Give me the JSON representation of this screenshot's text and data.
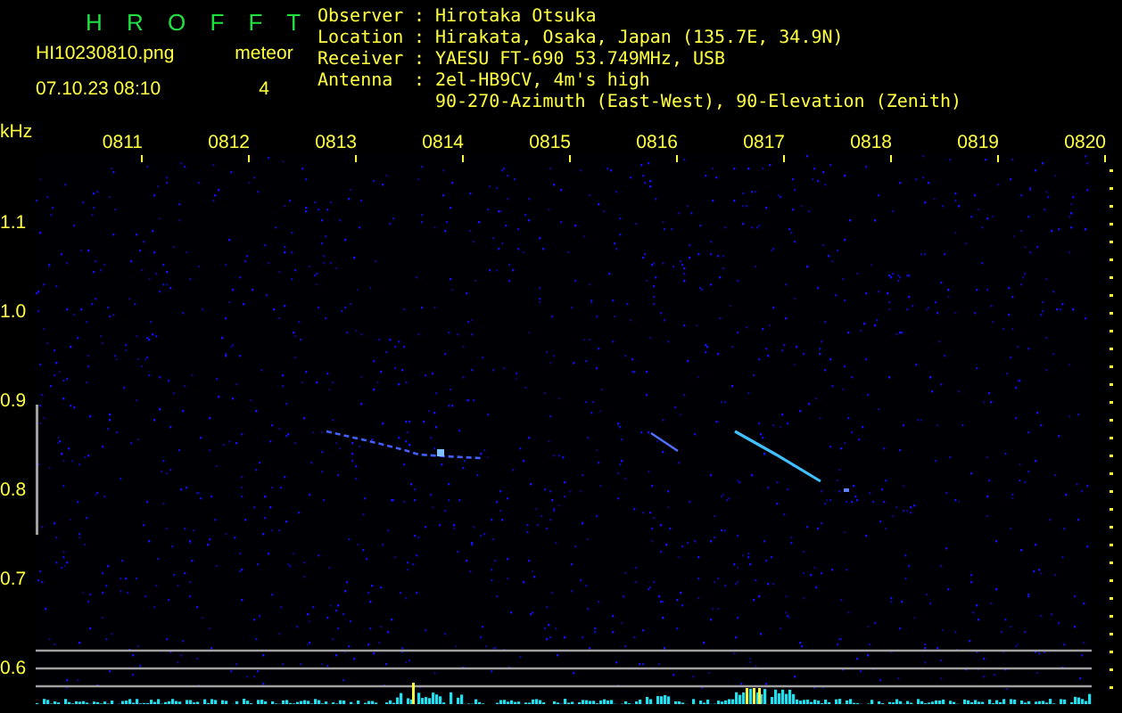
{
  "header": {
    "title": "H R O F F T",
    "filename": "HI10230810.png",
    "timestamp": "07.10.23 08:10",
    "meteor_label": "meteor",
    "meteor_count": "4"
  },
  "info": [
    {
      "label": "Observer",
      "separator": ":",
      "lines": [
        "Hirotaka Otsuka"
      ]
    },
    {
      "label": "Location",
      "separator": ":",
      "lines": [
        "Hirakata, Osaka, Japan (135.7E, 34.9N)"
      ]
    },
    {
      "label": "Receiver",
      "separator": ":",
      "lines": [
        "YAESU FT-690 53.749MHz, USB"
      ]
    },
    {
      "label": "Antenna",
      "separator": ":",
      "lines": [
        "2el-HB9CV, 4m's high",
        "90-270-Azimuth (East-West), 90-Elevation (Zenith)"
      ]
    }
  ],
  "axis": {
    "unit": "kHz",
    "time_ticks": [
      "0811",
      "0812",
      "0813",
      "0814",
      "0815",
      "0816",
      "0817",
      "0818",
      "0819",
      "0820"
    ],
    "freq_ticks": [
      "1.1",
      "1.0",
      "0.9",
      "0.8",
      "0.7",
      "0.6"
    ]
  }
}
